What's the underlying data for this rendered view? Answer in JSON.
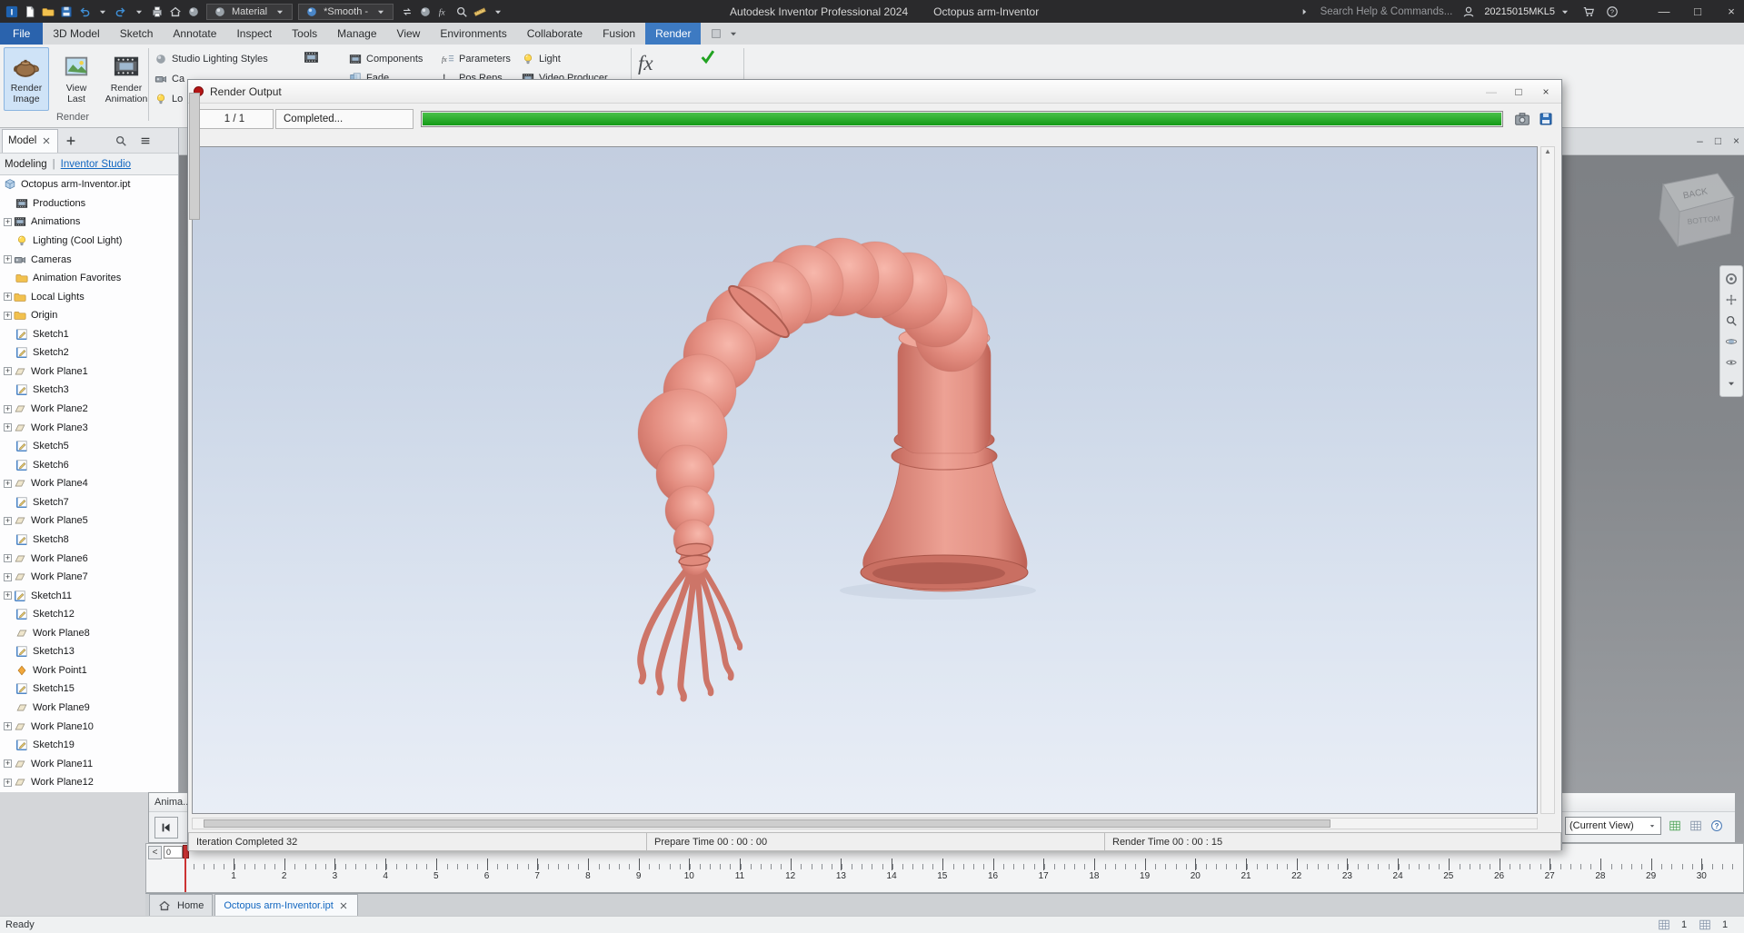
{
  "titlebar": {
    "quick_icons_left": [
      "app-logo",
      "new-file",
      "open-folder",
      "save",
      "undo",
      "caret-down",
      "redo",
      "caret-down",
      "print",
      "home",
      "sphere"
    ],
    "material_select": "Material",
    "appearance_select": "*Smooth -",
    "quick_icons_right": [
      "swap",
      "sphere",
      "fx",
      "search",
      "measure",
      "caret-down"
    ],
    "title_product": "Autodesk Inventor Professional 2024",
    "title_doc": "Octopus arm-Inventor",
    "search_text": "Search Help & Commands...",
    "account_id": "20215015MKL5"
  },
  "ribbon": {
    "tabs": [
      {
        "label": "File",
        "style": "file"
      },
      {
        "label": "3D Model",
        "style": ""
      },
      {
        "label": "Sketch",
        "style": ""
      },
      {
        "label": "Annotate",
        "style": ""
      },
      {
        "label": "Inspect",
        "style": ""
      },
      {
        "label": "Tools",
        "style": ""
      },
      {
        "label": "Manage",
        "style": ""
      },
      {
        "label": "View",
        "style": ""
      },
      {
        "label": "Environments",
        "style": ""
      },
      {
        "label": "Collaborate",
        "style": ""
      },
      {
        "label": "Fusion",
        "style": ""
      },
      {
        "label": "Render",
        "style": "active"
      }
    ],
    "big_buttons": [
      {
        "line1": "Render",
        "line2": "Image",
        "icon": "teapot",
        "selected": true
      },
      {
        "line1": "View",
        "line2": "Last",
        "icon": "photo",
        "selected": false
      },
      {
        "line1": "Render",
        "line2": "Animation",
        "icon": "film",
        "selected": false
      }
    ],
    "group_label": "Render",
    "scene_rows": [
      {
        "icon": "sphere",
        "label": "Studio Lighting Styles"
      },
      {
        "icon": "camera",
        "label": "Ca"
      },
      {
        "icon": "bulb",
        "label": "Lo"
      }
    ],
    "animate_cols": [
      [
        {
          "icon": "film",
          "label": "Components"
        },
        {
          "icon": "fade",
          "label": "Fade"
        }
      ],
      [
        {
          "icon": "fxtable",
          "label": "Parameters"
        },
        {
          "icon": "axes",
          "label": "Pos Reps"
        }
      ],
      [
        {
          "icon": "bulb",
          "label": "Light"
        },
        {
          "icon": "film",
          "label": "Video Producer"
        }
      ]
    ],
    "fx_label": "fx"
  },
  "browser": {
    "panel_tab": "Model",
    "mode_left": "Modeling",
    "mode_right": "Inventor Studio",
    "tree": [
      {
        "l": "Octopus arm-Inventor.ipt",
        "i": "part",
        "e": false,
        "r": true
      },
      {
        "l": "Productions",
        "i": "film",
        "e": false
      },
      {
        "l": "Animations",
        "i": "film",
        "e": true
      },
      {
        "l": "Lighting (Cool Light)",
        "i": "bulb",
        "e": false
      },
      {
        "l": "Cameras",
        "i": "camera",
        "e": true
      },
      {
        "l": "Animation Favorites",
        "i": "folder",
        "e": false
      },
      {
        "l": "Local Lights",
        "i": "folder",
        "e": true
      },
      {
        "l": "Origin",
        "i": "folder",
        "e": true
      },
      {
        "l": "Sketch1",
        "i": "sketch",
        "e": false
      },
      {
        "l": "Sketch2",
        "i": "sketch",
        "e": false
      },
      {
        "l": "Work Plane1",
        "i": "plane",
        "e": true
      },
      {
        "l": "Sketch3",
        "i": "sketch",
        "e": false
      },
      {
        "l": "Work Plane2",
        "i": "plane",
        "e": true
      },
      {
        "l": "Work Plane3",
        "i": "plane",
        "e": true
      },
      {
        "l": "Sketch5",
        "i": "sketch",
        "e": false
      },
      {
        "l": "Sketch6",
        "i": "sketch",
        "e": false
      },
      {
        "l": "Work Plane4",
        "i": "plane",
        "e": true
      },
      {
        "l": "Sketch7",
        "i": "sketch",
        "e": false
      },
      {
        "l": "Work Plane5",
        "i": "plane",
        "e": true
      },
      {
        "l": "Sketch8",
        "i": "sketch",
        "e": false
      },
      {
        "l": "Work Plane6",
        "i": "plane",
        "e": true
      },
      {
        "l": "Work Plane7",
        "i": "plane",
        "e": true
      },
      {
        "l": "Sketch11",
        "i": "sketch",
        "e": true
      },
      {
        "l": "Sketch12",
        "i": "sketch",
        "e": false
      },
      {
        "l": "Work Plane8",
        "i": "plane",
        "e": false
      },
      {
        "l": "Sketch13",
        "i": "sketch",
        "e": false
      },
      {
        "l": "Work Point1",
        "i": "point",
        "e": false
      },
      {
        "l": "Sketch15",
        "i": "sketch",
        "e": false
      },
      {
        "l": "Work Plane9",
        "i": "plane",
        "e": false
      },
      {
        "l": "Work Plane10",
        "i": "plane",
        "e": true
      },
      {
        "l": "Sketch19",
        "i": "sketch",
        "e": false
      },
      {
        "l": "Work Plane11",
        "i": "plane",
        "e": true
      },
      {
        "l": "Work Plane12",
        "i": "plane",
        "e": true
      }
    ]
  },
  "dialog": {
    "title": "Render Output",
    "pages": "1 / 1",
    "status": "Completed...",
    "progress_percent": 100,
    "footer_iteration": "Iteration Completed  32",
    "footer_prepare": "Prepare Time  00 : 00 : 00",
    "footer_render": "Render Time  00 : 00 : 15"
  },
  "animation_bar": {
    "title": "Anima...",
    "current_view": "(Current View)"
  },
  "timeline": {
    "marker": "0",
    "numbers": [
      1,
      2,
      3,
      4,
      5,
      6,
      7,
      8,
      9,
      10,
      11,
      12,
      13,
      14,
      15,
      16,
      17,
      18,
      19,
      20,
      21,
      22,
      23,
      24,
      25,
      26,
      27,
      28,
      29,
      30
    ]
  },
  "doc_tabs": [
    {
      "label": "Home",
      "active": false
    },
    {
      "label": "Octopus arm-Inventor.ipt",
      "active": true
    }
  ],
  "viewport": {
    "viewcube_top": "BACK",
    "viewcube_front": "BOTTOM"
  },
  "statusbar": {
    "message": "Ready",
    "cells": [
      "1",
      "1"
    ]
  }
}
